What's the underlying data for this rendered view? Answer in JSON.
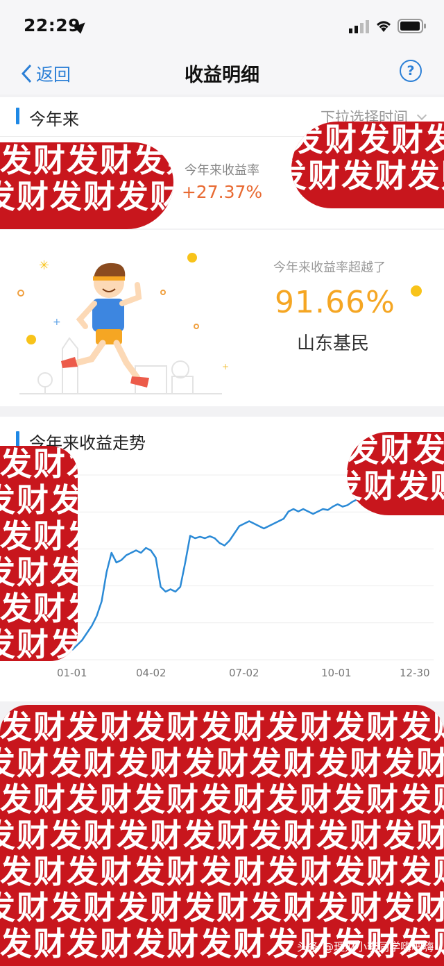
{
  "status_bar": {
    "time": "22:29"
  },
  "nav": {
    "back_label": "返回",
    "title": "收益明细",
    "help_symbol": "?"
  },
  "period": {
    "section_title": "今年来",
    "picker_label": "下拉选择时间"
  },
  "return": {
    "label": "今年来收益率",
    "value": "+27.37%"
  },
  "rank": {
    "label": "今年来收益率超越了",
    "percent": "91.66%",
    "group": "山东基民"
  },
  "trend": {
    "section_title": "今年来收益走势"
  },
  "chart_data": {
    "type": "line",
    "x_ticks": [
      "01-01",
      "04-02",
      "07-02",
      "10-01",
      "12-30"
    ],
    "x": [
      0,
      5,
      10,
      15,
      20,
      25,
      30,
      35,
      40,
      45,
      50,
      55,
      60,
      65,
      70,
      75,
      80,
      85,
      90,
      95,
      100,
      105,
      110,
      115,
      120,
      125,
      130,
      135,
      140,
      145,
      150,
      155,
      160,
      165,
      170,
      175,
      180,
      185,
      190,
      195,
      200,
      205,
      210,
      215,
      220,
      225,
      230,
      235,
      240,
      245,
      250,
      255,
      260,
      265,
      270,
      275,
      280,
      285,
      290,
      295,
      300,
      305,
      310,
      315,
      320,
      325,
      330,
      335,
      340,
      345,
      350,
      355,
      364
    ],
    "y": [
      0.0,
      1.0,
      2.0,
      3.5,
      5.0,
      7.0,
      10.0,
      16.0,
      20.0,
      18.0,
      18.5,
      19.5,
      20.0,
      20.5,
      20.0,
      21.0,
      20.5,
      19.0,
      13.0,
      12.0,
      12.5,
      12.0,
      13.0,
      18.0,
      23.5,
      23.0,
      23.3,
      23.0,
      23.4,
      23.0,
      22.0,
      21.5,
      22.5,
      24.0,
      25.5,
      26.0,
      26.5,
      26.0,
      25.5,
      25.0,
      25.5,
      26.0,
      26.5,
      27.0,
      28.5,
      29.0,
      28.5,
      29.0,
      28.5,
      28.0,
      28.5,
      29.0,
      28.8,
      29.5,
      30.0,
      29.5,
      29.8,
      30.5,
      31.0,
      30.5,
      30.0,
      29.5,
      29.0,
      29.5,
      30.0,
      29.5,
      30.0,
      30.5,
      30.0,
      30.5,
      31.0,
      31.0,
      31.5
    ],
    "grid": true,
    "color": "#2b8ad6"
  },
  "watermark": {
    "text": "发财发财发财发财发财发财发财发财发财发财",
    "color": "#c8161d"
  },
  "footer": {
    "credit": "头条 @理财小李同学嗨吧嗨"
  }
}
